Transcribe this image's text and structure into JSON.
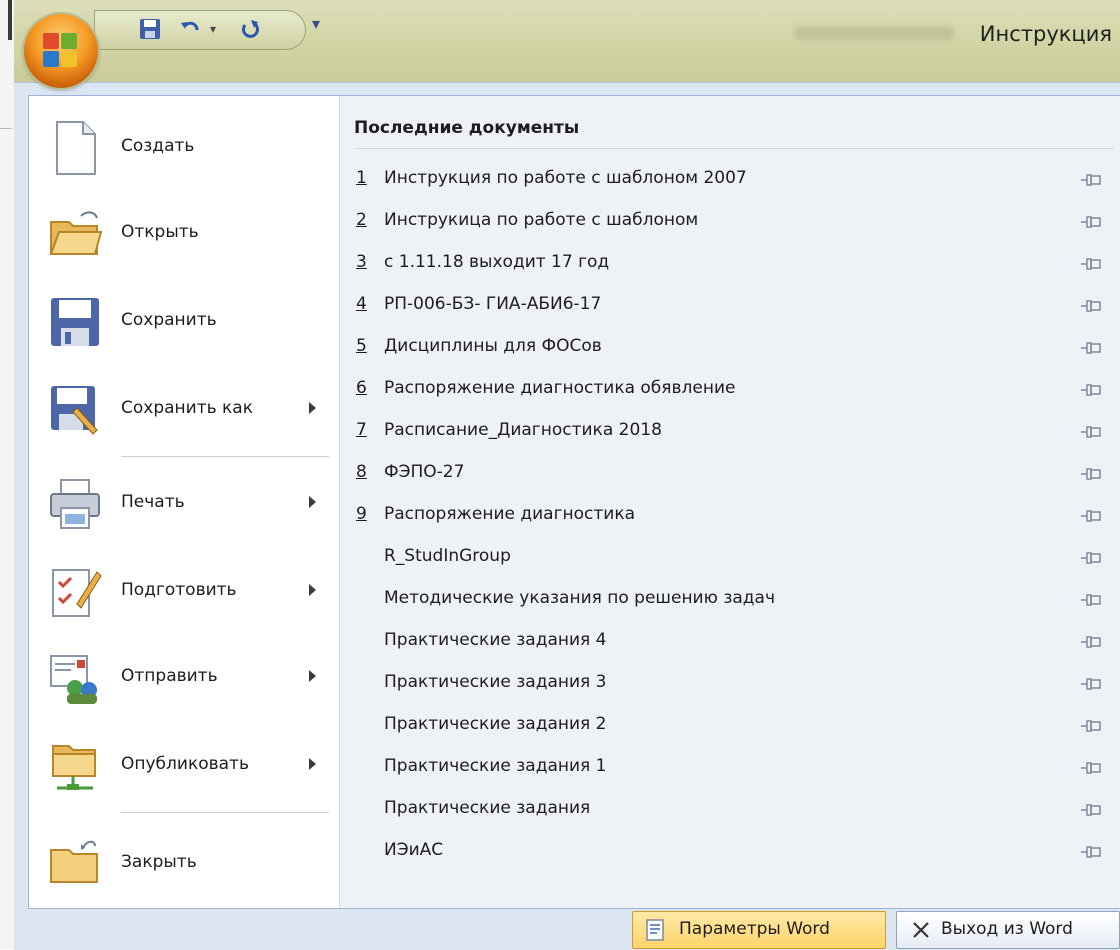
{
  "title_bar": {
    "title": "Инструкция"
  },
  "commands": [
    {
      "label": "Создать",
      "icon": "new-document-icon",
      "submenu": false
    },
    {
      "label": "Открыть",
      "icon": "open-folder-icon",
      "submenu": false
    },
    {
      "label": "Сохранить",
      "icon": "save-disk-icon",
      "submenu": false
    },
    {
      "label": "Сохранить как",
      "icon": "save-as-icon",
      "submenu": true
    },
    {
      "label": "Печать",
      "icon": "printer-icon",
      "submenu": true
    },
    {
      "label": "Подготовить",
      "icon": "prepare-icon",
      "submenu": true
    },
    {
      "label": "Отправить",
      "icon": "send-icon",
      "submenu": true
    },
    {
      "label": "Опубликовать",
      "icon": "publish-icon",
      "submenu": true
    },
    {
      "label": "Закрыть",
      "icon": "close-folder-icon",
      "submenu": false
    }
  ],
  "recent": {
    "title": "Последние документы",
    "items": [
      {
        "num": "1",
        "name": "Инструкция по работе с шаблоном 2007"
      },
      {
        "num": "2",
        "name": "Инструкица по работе с шаблоном"
      },
      {
        "num": "3",
        "name": "с 1.11.18 выходит 17 год"
      },
      {
        "num": "4",
        "name": "РП-006-БЗ- ГИА-АБИ6-17"
      },
      {
        "num": "5",
        "name": "Дисциплины для ФОСов"
      },
      {
        "num": "6",
        "name": "Распоряжение диагностика обявление"
      },
      {
        "num": "7",
        "name": "Расписание_Диагностика 2018"
      },
      {
        "num": "8",
        "name": "ФЭПО-27"
      },
      {
        "num": "9",
        "name": "Распоряжение диагностика"
      },
      {
        "num": "",
        "name": "R_StudInGroup"
      },
      {
        "num": "",
        "name": "Методические указания по решению задач"
      },
      {
        "num": "",
        "name": "Практические задания 4"
      },
      {
        "num": "",
        "name": "Практические задания 3"
      },
      {
        "num": "",
        "name": "Практические задания 2"
      },
      {
        "num": "",
        "name": "Практические задания 1"
      },
      {
        "num": "",
        "name": "Практические задания"
      },
      {
        "num": "",
        "name": "ИЭиАС"
      }
    ]
  },
  "footer": {
    "options_label": "Параметры Word",
    "exit_label": "Выход из Word"
  },
  "colors": {
    "menu_bg": "#dbe6f2",
    "recent_bg": "#eef1f6",
    "orb": "#f59a24",
    "titlebar": "#d4d7a9"
  }
}
